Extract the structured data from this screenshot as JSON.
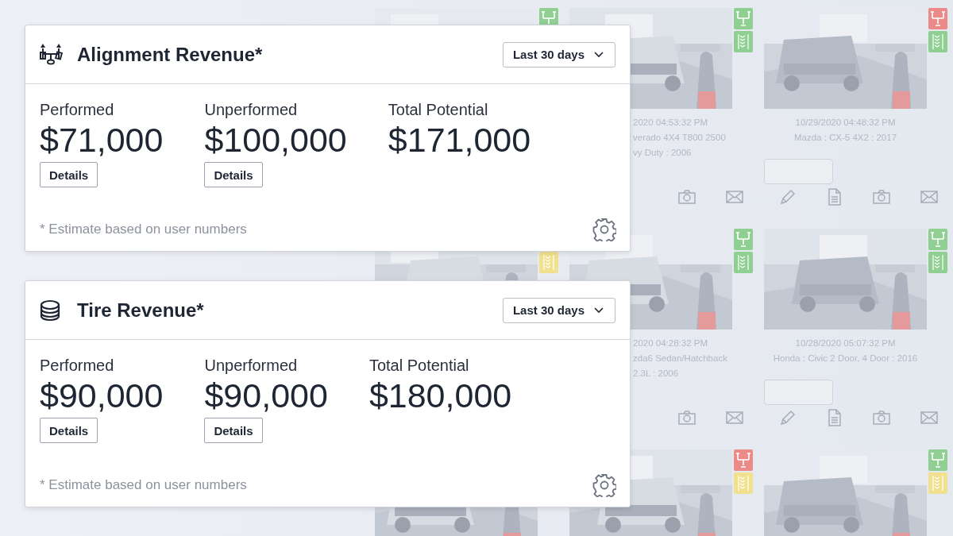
{
  "cards": [
    {
      "kind": "alignment",
      "title": "Alignment Revenue*",
      "range": "Last 30 days",
      "metrics": [
        {
          "label": "Performed",
          "value": "$71,000",
          "details": "Details"
        },
        {
          "label": "Unperformed",
          "value": "$100,000",
          "details": "Details"
        },
        {
          "label": "Total Potential",
          "value": "$171,000"
        }
      ],
      "footnote": "* Estimate based on user numbers"
    },
    {
      "kind": "tire",
      "title": "Tire Revenue*",
      "range": "Last 30 days",
      "metrics": [
        {
          "label": "Performed",
          "value": "$90,000",
          "details": "Details"
        },
        {
          "label": "Unperformed",
          "value": "$90,000",
          "details": "Details"
        },
        {
          "label": "Total Potential",
          "value": "$180,000"
        }
      ],
      "footnote": "* Estimate based on user numbers"
    }
  ],
  "background_tiles": [
    {
      "badges": [
        {
          "kind": "alignment",
          "color": "#8fcf91"
        }
      ]
    },
    {
      "badges": [
        {
          "kind": "alignment",
          "color": "#8fcf91"
        },
        {
          "kind": "tire",
          "color": "#8fcf91"
        }
      ],
      "lines": [
        "2020 04:53:32 PM",
        "verado 4X4 T800 2500",
        "vy Duty : 2006"
      ],
      "actions": [
        {
          "kind": "camera"
        },
        {
          "kind": "mail"
        }
      ]
    },
    {
      "badges": [
        {
          "kind": "alignment",
          "color": "#ec8a8a"
        },
        {
          "kind": "tire",
          "color": "#8fcf91"
        }
      ],
      "lines": [
        "10/29/2020 04:48:32 PM",
        "Mazda : CX-5 4X2 : 2017"
      ],
      "plate_field": true,
      "actions": [
        {
          "kind": "edit"
        },
        {
          "kind": "document"
        },
        {
          "kind": "camera"
        },
        {
          "kind": "mail"
        }
      ]
    },
    {
      "badges": [
        {
          "kind": "tire",
          "color": "#f1e08e"
        }
      ]
    },
    {
      "badges": [
        {
          "kind": "alignment",
          "color": "#8fcf91"
        },
        {
          "kind": "tire",
          "color": "#8fcf91"
        }
      ],
      "lines": [
        "2020 04:28:32 PM",
        "zda6 Sedan/Hatchback",
        "2.3L : 2006"
      ],
      "actions": [
        {
          "kind": "camera"
        },
        {
          "kind": "mail"
        }
      ]
    },
    {
      "badges": [
        {
          "kind": "alignment",
          "color": "#8fcf91"
        },
        {
          "kind": "tire",
          "color": "#8fcf91"
        }
      ],
      "lines": [
        "10/28/2020 05:07:32 PM",
        "Honda : Civic 2 Door, 4 Door : 2016"
      ],
      "plate_field": true,
      "actions": [
        {
          "kind": "edit"
        },
        {
          "kind": "document"
        },
        {
          "kind": "camera"
        },
        {
          "kind": "mail"
        }
      ]
    },
    {
      "kind": "picture"
    },
    {
      "badges": [
        {
          "kind": "alignment",
          "color": "#ec8a8a"
        },
        {
          "kind": "tire",
          "color": "#f1e08e"
        }
      ]
    },
    {
      "badges": [
        {
          "kind": "alignment",
          "color": "#8fcf91"
        },
        {
          "kind": "tire",
          "color": "#f1e08e"
        }
      ]
    }
  ]
}
